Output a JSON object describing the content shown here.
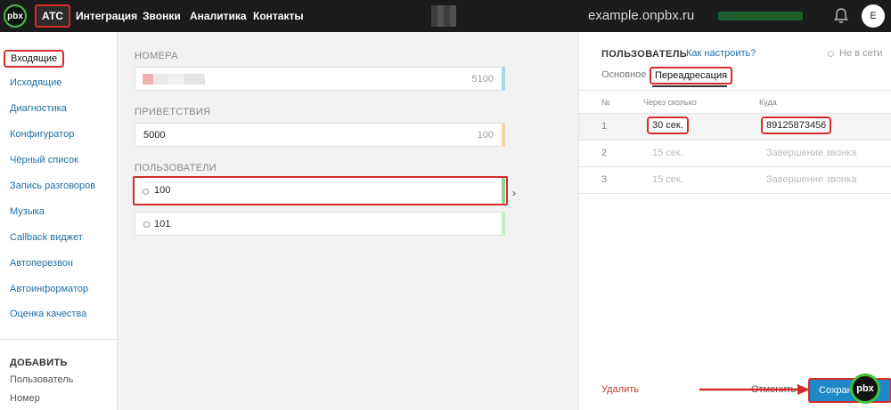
{
  "topbar": {
    "logo_text": "pbx",
    "nav": [
      "АТС",
      "Интеграция",
      "Звонки",
      "Аналитика",
      "Контакты"
    ],
    "domain": "example.onpbx.ru",
    "avatar_letter": "E",
    "bell_icon": "bell-icon"
  },
  "sidebar": {
    "items": [
      "Входящие",
      "Исходящие",
      "Диагностика",
      "Конфигуратор",
      "Чёрный список",
      "Запись разговоров",
      "Музыка",
      "Callback виджет",
      "Автоперезвон",
      "Автоинформатор",
      "Оценка качества"
    ],
    "add_header": "ДОБАВИТЬ",
    "add_links": [
      "Пользователь",
      "Номер"
    ]
  },
  "middle": {
    "numbers_title": "НОМЕРА",
    "number_ext": "5100",
    "greetings_title": "ПРИВЕТСТВИЯ",
    "greeting_name": "5000",
    "greeting_value": "100",
    "users_title": "ПОЛЬЗОВАТЕЛИ",
    "users": [
      "100",
      "101"
    ]
  },
  "panel": {
    "title": "ПОЛЬЗОВАТЕЛЬ",
    "howto": "Как настроить?",
    "status": "Не в сети",
    "tabs": [
      "Основное",
      "Переадресация"
    ],
    "headers": [
      "№",
      "Через сколько",
      "Куда"
    ],
    "rows": [
      {
        "num": "1",
        "delay": "30 сек.",
        "dest": "89125873456"
      },
      {
        "num": "2",
        "delay": "15 сек.",
        "dest": "Завершение звонка"
      },
      {
        "num": "3",
        "delay": "15 сек.",
        "dest": "Завершение звонка"
      }
    ],
    "delete_label": "Удалить",
    "cancel_label": "Отменить",
    "save_label": "Сохранить"
  },
  "colors": {
    "accent": "#1e88c8",
    "highlight": "#d62b2b",
    "topbar": "#1b1b1b",
    "logo_ring": "#3fc43f"
  }
}
